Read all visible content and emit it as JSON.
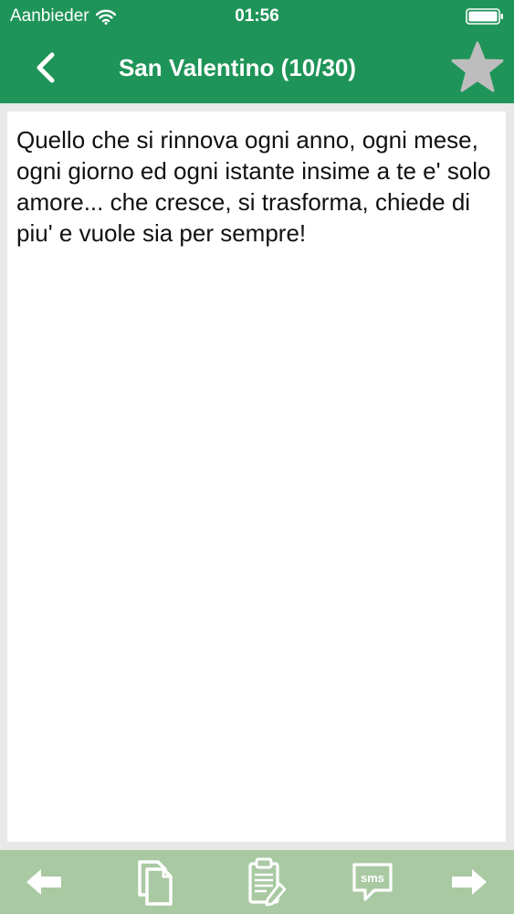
{
  "status_bar": {
    "carrier": "Aanbieder",
    "time": "01:56"
  },
  "nav": {
    "title": "San Valentino (10/30)",
    "back_icon": "chevron-left-icon",
    "favorite_icon": "star-icon"
  },
  "message": {
    "text": "Quello che si rinnova ogni anno, ogni mese, ogni giorno ed ogni istante insime a te e' solo amore... che cresce, si trasforma, chiede di piu' e vuole sia per sempre!"
  },
  "toolbar": {
    "sms_label": "sms",
    "items": [
      "arrow-left-icon",
      "copy-icon",
      "clipboard-edit-icon",
      "sms-icon",
      "arrow-right-icon"
    ]
  },
  "colors": {
    "header": "#1f9458",
    "toolbar": "#a9c9a3",
    "background": "#e8e8e8",
    "star": "#bdbdbd"
  }
}
